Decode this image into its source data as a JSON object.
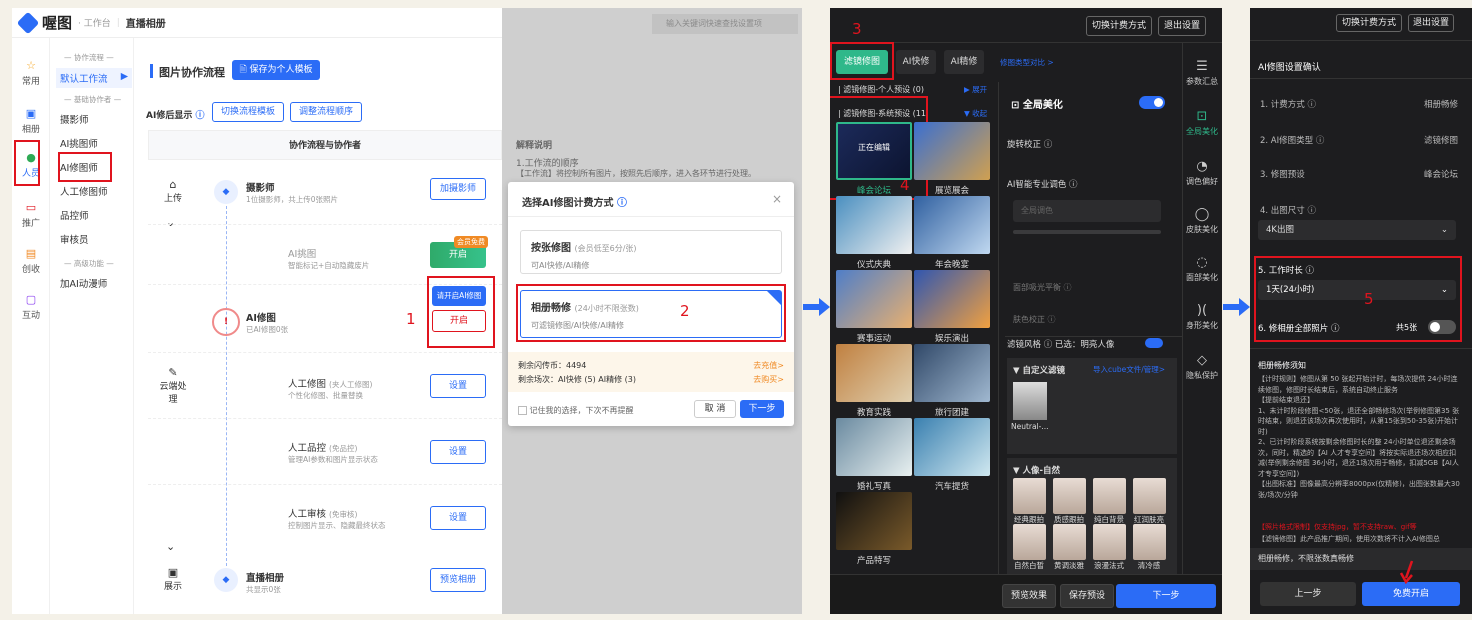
{
  "p1": {
    "brand": "喔图",
    "workbench": "· 工作台",
    "crumb": "直播相册",
    "left_nav": [
      "常用",
      "相册",
      "人员",
      "推广",
      "创收",
      "互动"
    ],
    "sub_nav": {
      "sec1": "— 协作流程 —",
      "default_flow": "默认工作流",
      "sec2": "— 基础协作者 —",
      "items": [
        "摄影师",
        "AI挑图师",
        "AI修图师",
        "人工修图师",
        "品控师",
        "审核员"
      ],
      "sec3": "— 高级功能 —",
      "ai_comic": "加AI动漫师"
    },
    "title": "图片协作流程",
    "save_template": "🗎 保存为个人模板",
    "ai_show": "AI修后显示",
    "switch_template": "切换流程模板",
    "adjust_order": "调整流程顺序",
    "col_header": "协作流程与协作者",
    "steps": [
      {
        "label": "上传"
      },
      {
        "label": "云端处理"
      },
      {
        "label": "展示"
      }
    ],
    "rows": [
      {
        "name": "摄影师",
        "desc": "1位摄影师，共上传0张照片",
        "btn": "加摄影师"
      },
      {
        "name": "AI挑图",
        "desc": "智能标记+自动隐藏废片",
        "btn": "开启",
        "badge": "会员免费"
      },
      {
        "name": "AI修图",
        "desc": "已AI修图0张",
        "btn": "开启",
        "tip": "请开启AI修图"
      },
      {
        "name": "人工修图",
        "tag": "(夹人工修图)",
        "desc": "个性化修图、批量替换",
        "btn": "设置"
      },
      {
        "name": "人工品控",
        "tag": "(免品控)",
        "desc": "管理AI参数和图片显示状态",
        "btn": "设置"
      },
      {
        "name": "人工审核",
        "tag": "(免审核)",
        "desc": "控制图片显示、隐藏最终状态",
        "btn": "设置"
      },
      {
        "name": "直播相册",
        "desc": "共显示0张",
        "btn": "预览相册"
      }
    ],
    "marker": "1"
  },
  "p2": {
    "search_placeholder": "输入关键词快速查找设置项",
    "explain_title": "解释说明",
    "explain_1": "1.工作流的顺序",
    "explain_2": "【工作流】将控制所有图片，按照先后顺序，进入各环节进行处理。",
    "dialog_title": "选择AI修图计费方式",
    "opt1_title": "按张修图",
    "opt1_note": "(会员低至6分/张)",
    "opt1_desc": "可AI快修/AI精修",
    "opt2_title": "相册畅修",
    "opt2_note": "(24小时不限张数)",
    "opt2_desc": "可滤镜修图/AI快修/AI精修",
    "marker": "2",
    "remain1": "剩余闪传币：4494",
    "remain2": "剩余场次：AI快修 (5) AI精修 (3)",
    "recharge": "去充值>",
    "buy": "去购买>",
    "remember": "记住我的选择，下次不再提醒",
    "cancel": "取 消",
    "next": "下一步"
  },
  "p3": {
    "switch_btn": "切换计费方式",
    "exit_btn": "退出设置",
    "tabs": [
      "滤镜修图",
      "AI快修",
      "AI精修"
    ],
    "compare": "修图类型对比 >",
    "preset_personal": "| 滤镜修图-个人预设 (0)",
    "expand": "▶ 展开",
    "preset_system": "| 滤镜修图-系统预设 (11",
    "collapse": "▼ 收起",
    "editing": "正在编辑",
    "thumbs": [
      "峰会论坛",
      "展览展会",
      "仪式庆典",
      "年会晚宴",
      "赛事运动",
      "娱乐演出",
      "教育实践",
      "旅行团建",
      "婚礼写真",
      "汽车提货",
      "产品特写"
    ],
    "markers": [
      "3",
      "4"
    ],
    "global": "全局美化",
    "settings": [
      "旋转校正 ⓘ",
      "AI智能专业调色 ⓘ",
      "全局调色",
      "面部吸光平衡 ⓘ",
      "肤色校正 ⓘ"
    ],
    "style_label": "滤镜风格 ⓘ 已选：明亮人像",
    "custom": "▼ 自定义滤镜",
    "import": "导入cube文件/管理>",
    "neutral": "Neutral-...",
    "portrait": "▼ 人像-自然",
    "faces": [
      "经典跟拍",
      "质感跟拍",
      "纯白背景",
      "红润肤亮",
      "自然白皙",
      "黄调淡雅",
      "浪漫法式",
      "清冷感"
    ],
    "right_nav": [
      "参数汇总",
      "全局美化",
      "调色偏好",
      "皮肤美化",
      "面部美化",
      "身形美化",
      "隐私保护"
    ],
    "preview": "预览效果",
    "save_preset": "保存预设",
    "next": "下一步"
  },
  "p4": {
    "switch_btn": "切换计费方式",
    "exit_btn": "退出设置",
    "title": "AI修图设置确认",
    "fields": [
      {
        "k": "1. 计费方式 ⓘ",
        "v": "相册畅修"
      },
      {
        "k": "2. AI修图类型 ⓘ",
        "v": "滤镜修图"
      },
      {
        "k": "3. 修图预设",
        "v": "峰会论坛"
      }
    ],
    "size_label": "4. 出图尺寸 ⓘ",
    "size_val": "4K出图",
    "dur_label": "5. 工作时长 ⓘ",
    "dur_val": "1天(24小时)",
    "marker": "5",
    "all_label": "6. 修相册全部照片 ⓘ",
    "all_count": "共5张",
    "notice_title": "相册畅修须知",
    "notice": "【计时规则】修图从第 50 张起开始计时，每场次提供 24小时连续修图，修图时长结束后，系统自动终止服务\n【提前结束退还】\n1、未计时阶段修图<50张，退还全部畅修场次(举例修图第35 张时结束，则退还该场次再次使用时，从第15张到50-35张)开始计时)\n2、已计时阶段系统按剩余修图时长的整 24小时单位退还剩余场次，同时，精选的【AI 人才专享空间】将按实际退还场次相应扣减(举例剩余修图 36小时，退还1场次用于畅修，扣减5GB【AI人才专享空间】)\n【出图标准】图像最高分辨率8000px(仅精修)，出图张数最大30张/场次/分钟",
    "format_warn": "【照片格式限制】仅支持jpg，暂不支持raw、gif等",
    "notice2": "【滤镜修图】此产品推广期间，使用次数将不计入AI修图总",
    "bottom_note": "相册畅修，不限张数真畅修",
    "prev": "上一步",
    "start": "免费开启"
  },
  "colors": {
    "accent": "#2b6cf6",
    "marker_red": "#e0141e",
    "dark_bg": "#1d1d1f"
  }
}
